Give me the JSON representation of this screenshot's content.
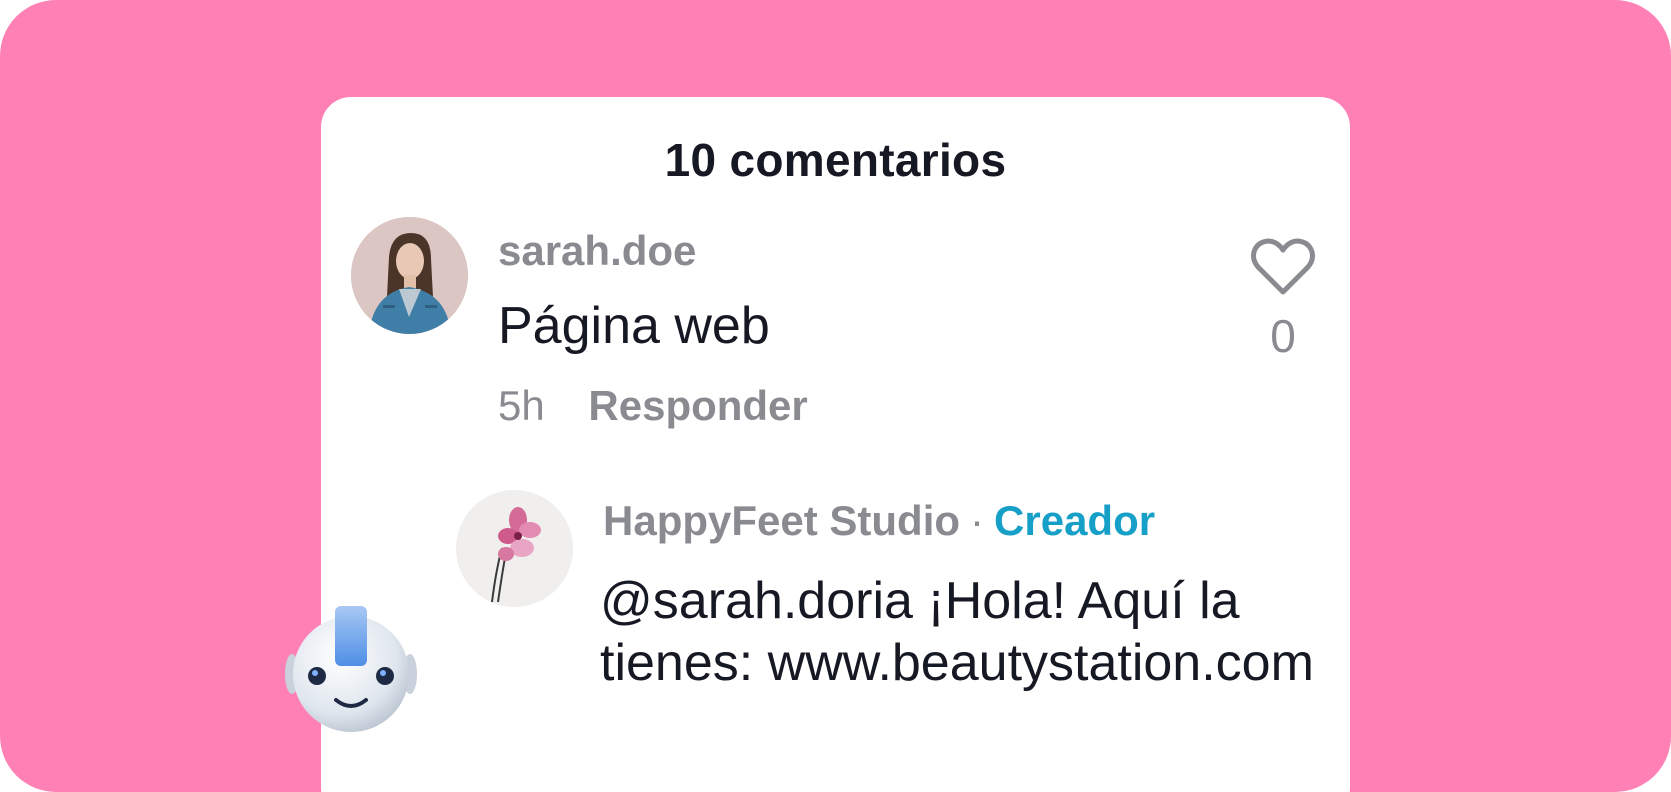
{
  "panel": {
    "title": "10 comentarios"
  },
  "comments": [
    {
      "username": "sarah.doe",
      "text": "Página web",
      "time": "5h",
      "reply_label": "Responder",
      "likes": "0",
      "avatar_icon": "user-photo-avatar"
    }
  ],
  "reply": {
    "username": "HappyFeet Studio",
    "separator": "·",
    "badge": "Creador",
    "text": "@sarah.doria ¡Hola! Aquí la tienes: www.beautystation.com",
    "avatar_icon": "orchid-avatar"
  },
  "colors": {
    "background": "#ff80b5",
    "card": "#ffffff",
    "primary_text": "#161823",
    "secondary_text": "#8a8b91",
    "creator_badge": "#169fc7"
  },
  "icons": {
    "like": "heart-outline-icon",
    "assistant": "robot-mascot-icon"
  }
}
